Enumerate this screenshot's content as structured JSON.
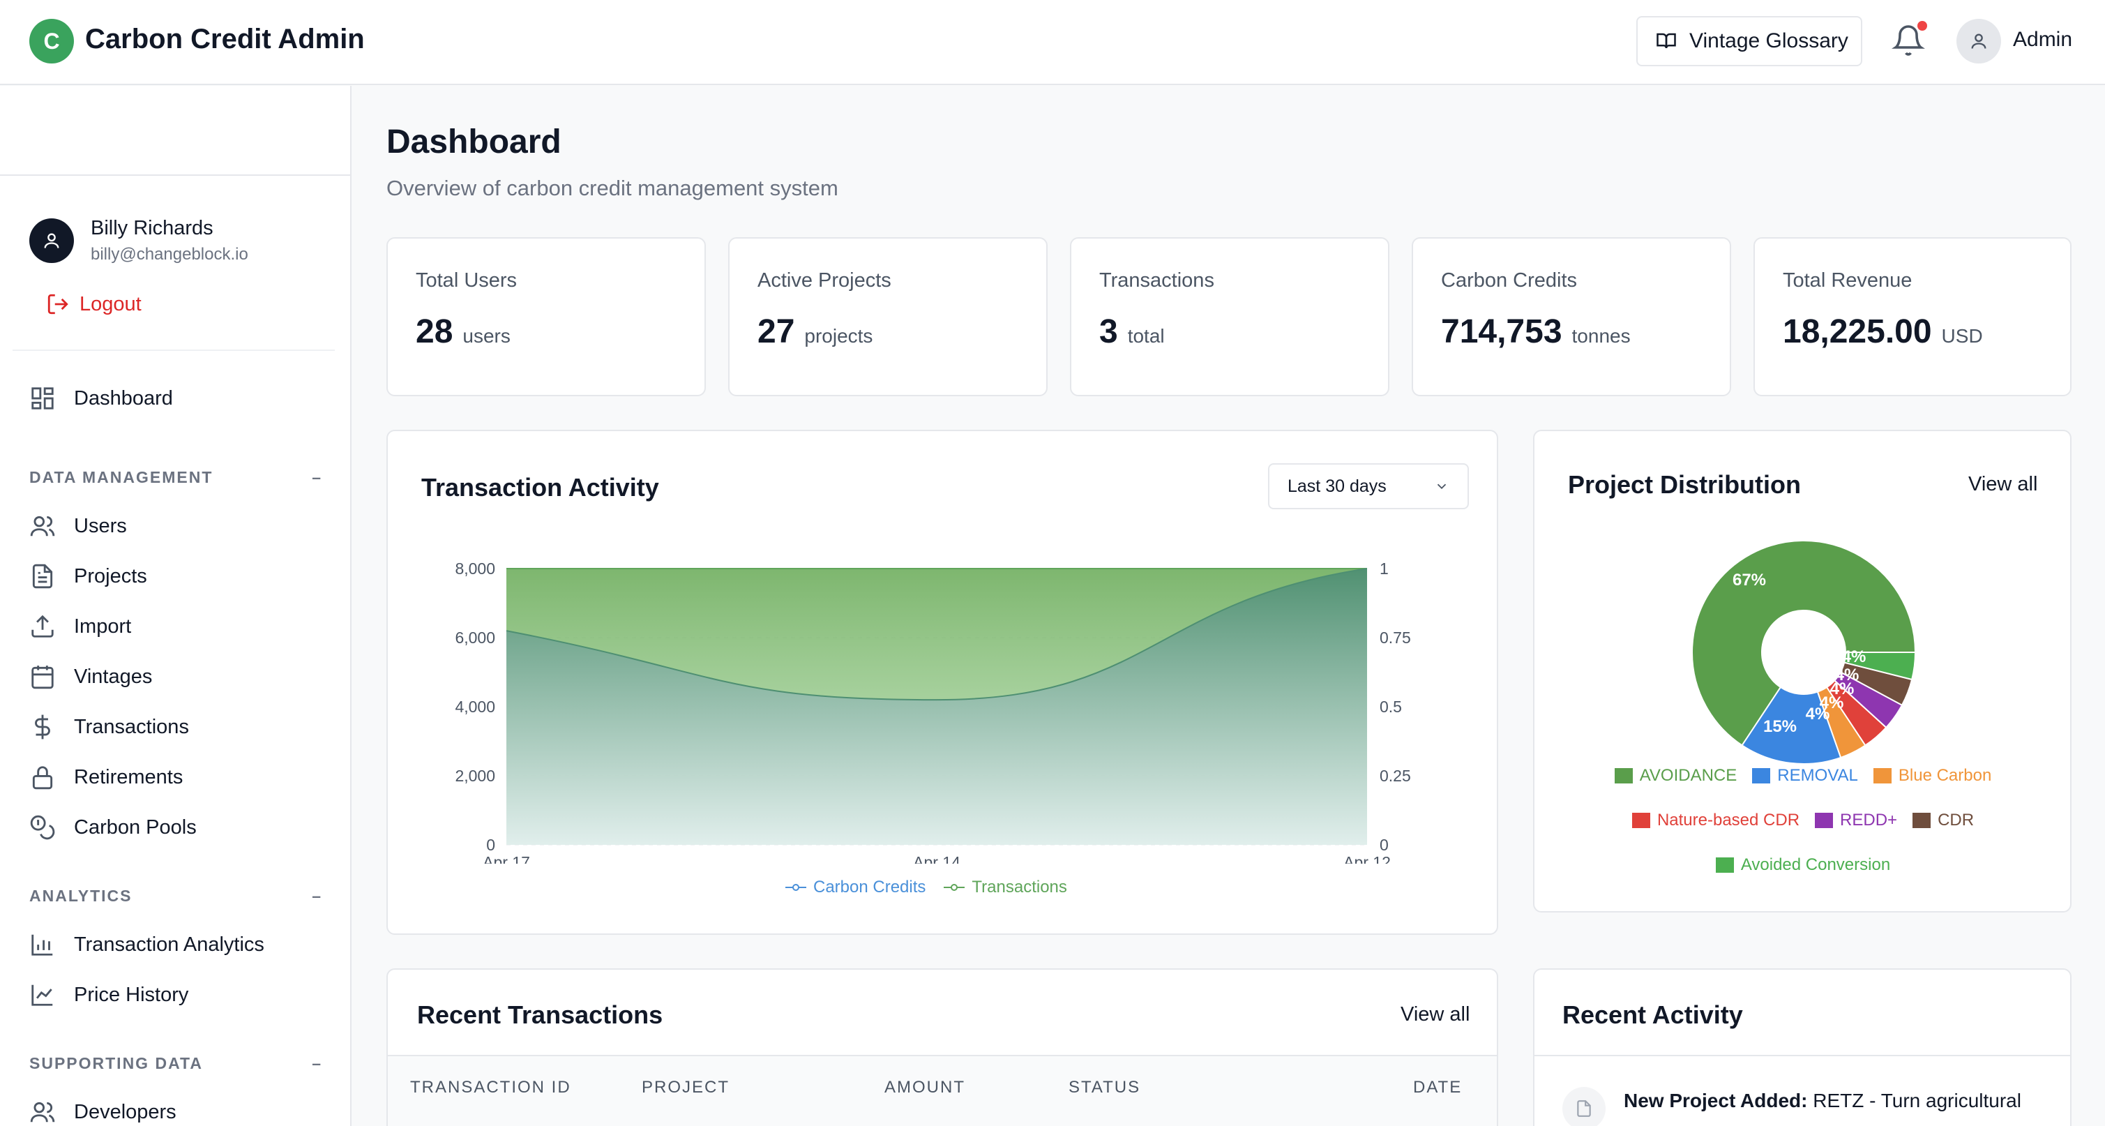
{
  "header": {
    "logo_letter": "C",
    "app_title": "Carbon Credit Admin",
    "glossary_label": "Vintage Glossary",
    "admin_label": "Admin"
  },
  "sidebar": {
    "user": {
      "name": "Billy Richards",
      "email": "billy@changeblock.io"
    },
    "logout_label": "Logout",
    "dashboard_label": "Dashboard",
    "sections": [
      {
        "label": "DATA MANAGEMENT",
        "toggle": "–",
        "items": [
          "Users",
          "Projects",
          "Import",
          "Vintages",
          "Transactions",
          "Retirements",
          "Carbon Pools"
        ]
      },
      {
        "label": "ANALYTICS",
        "toggle": "–",
        "items": [
          "Transaction Analytics",
          "Price History"
        ]
      },
      {
        "label": "SUPPORTING DATA",
        "toggle": "–",
        "items": [
          "Developers"
        ]
      }
    ]
  },
  "page": {
    "title": "Dashboard",
    "subtitle": "Overview of carbon credit management system"
  },
  "stats": [
    {
      "label": "Total Users",
      "value": "28",
      "unit": "users"
    },
    {
      "label": "Active Projects",
      "value": "27",
      "unit": "projects"
    },
    {
      "label": "Transactions",
      "value": "3",
      "unit": "total"
    },
    {
      "label": "Carbon Credits",
      "value": "714,753",
      "unit": "tonnes"
    },
    {
      "label": "Total Revenue",
      "value": "18,225.00",
      "unit": "USD"
    }
  ],
  "activity": {
    "title": "Transaction Activity",
    "range_select": "Last 30 days",
    "legend": [
      "Carbon Credits",
      "Transactions"
    ]
  },
  "distribution": {
    "title": "Project Distribution",
    "view_all": "View all"
  },
  "recent_transactions": {
    "title": "Recent Transactions",
    "view_all": "View all",
    "columns": [
      "TRANSACTION ID",
      "PROJECT",
      "AMOUNT",
      "STATUS",
      "DATE"
    ]
  },
  "recent_activity": {
    "title": "Recent Activity",
    "first_item_title": "New Project Added:",
    "first_item_text": "RETZ - Turn agricultural"
  },
  "colors": {
    "accent_green": "#3aa35d",
    "logout_red": "#dc2626",
    "credits_blue": "#4a90d9",
    "transactions_green": "#5fa55a"
  },
  "chart_data": [
    {
      "type": "area",
      "title": "Transaction Activity",
      "x": [
        "Apr 17",
        "Apr 14",
        "Apr 12"
      ],
      "x_ticks": [
        "Apr 17",
        "Apr 14",
        "Apr 12"
      ],
      "y_ticks_left": [
        "0",
        "2,000",
        "4,000",
        "6,000",
        "8,000"
      ],
      "y_ticks_right": [
        "0",
        "0.25",
        "0.5",
        "0.75",
        "1"
      ],
      "ylim_left": [
        0,
        8000
      ],
      "ylim_right": [
        0,
        1
      ],
      "series": [
        {
          "name": "Carbon Credits",
          "axis": "left",
          "values": [
            6200,
            4200,
            8000
          ],
          "color": "#5a9a7a"
        },
        {
          "name": "Transactions",
          "axis": "right",
          "values": [
            1,
            1,
            1
          ],
          "color": "#6fae5e"
        }
      ],
      "grid": true,
      "legend": "bottom"
    },
    {
      "type": "pie",
      "title": "Project Distribution",
      "labels": [
        "AVOIDANCE",
        "REMOVAL",
        "Blue Carbon",
        "Nature-based CDR",
        "REDD+",
        "CDR",
        "Avoided Conversion"
      ],
      "values": [
        67,
        15,
        4,
        4,
        4,
        4,
        4
      ],
      "slice_labels": [
        "67%",
        "15%",
        "4%",
        "4%",
        "4%",
        "4%",
        "4%"
      ],
      "colors": [
        "#5a9e4b",
        "#3b86e0",
        "#f0953a",
        "#e0413a",
        "#8e36b0",
        "#6f4e3d",
        "#4caf50"
      ],
      "legend": "bottom"
    }
  ]
}
